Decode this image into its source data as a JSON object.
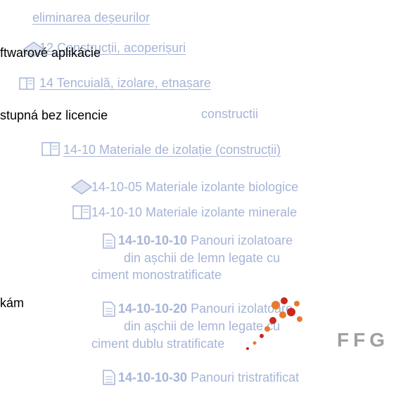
{
  "tree": {
    "partial_top_link": "eliminarea deșeurilor",
    "item_12": "12 Construcții, acoperișuri",
    "item_14": "14 Tencuială, izolare, etnașare",
    "item_subtitle_ghost": "constructii",
    "item_14_10": "14-10 Materiale de izolație (construcții)",
    "item_14_10_05": "14-10-05 Materiale izolante biologice",
    "item_14_10_10": "14-10-10 Materiale izolante minerale",
    "doc_1": {
      "code": "14-10-10-10",
      "line1_rest": " Panouri izolatoare",
      "line2": "din așchii de lemn legate cu",
      "line3": "ciment monostratificate"
    },
    "doc_2": {
      "code": "14-10-10-20",
      "line1_rest": " Panouri izolatoare",
      "line2": "din așchii de lemn legate cu",
      "line3": "ciment dublu stratificate"
    },
    "doc_3": {
      "code": "14-10-10-30",
      "line1_rest": " Panouri tristratificat"
    }
  },
  "overlay": {
    "text_1": "ftwarové aplikácie",
    "text_2": "stupná bez licencie",
    "text_3": "kám"
  },
  "logo": {
    "text": "FFG"
  },
  "colors": {
    "tree_text": "#a6b4d7",
    "overlay_text": "#000000",
    "logo_orange": "#e87a2f",
    "logo_red": "#c8281e"
  }
}
